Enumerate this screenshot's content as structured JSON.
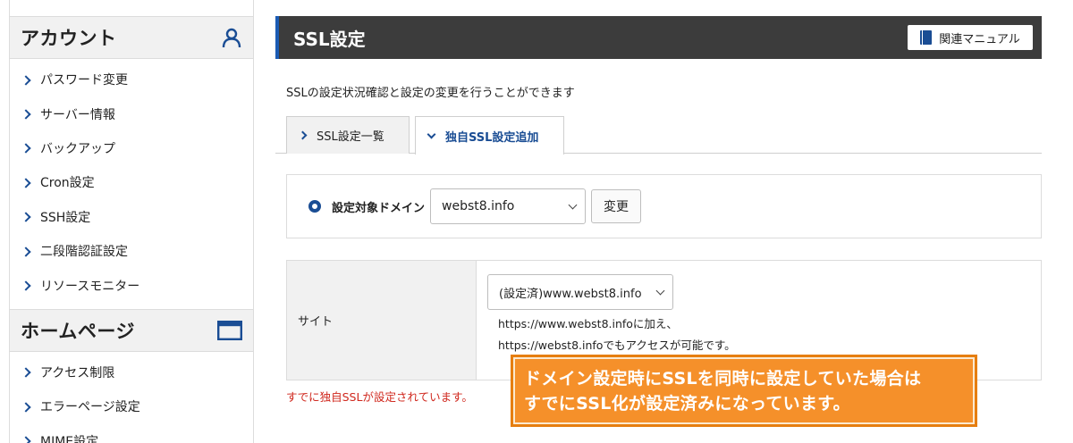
{
  "sidebar": {
    "account": {
      "title": "アカウント",
      "items": [
        {
          "label": "パスワード変更"
        },
        {
          "label": "サーバー情報"
        },
        {
          "label": "バックアップ"
        },
        {
          "label": "Cron設定"
        },
        {
          "label": "SSH設定"
        },
        {
          "label": "二段階認証設定"
        },
        {
          "label": "リソースモニター"
        }
      ]
    },
    "home": {
      "title": "ホームページ",
      "items": [
        {
          "label": "アクセス制限"
        },
        {
          "label": "エラーページ設定"
        },
        {
          "label": "MIME設定"
        }
      ]
    }
  },
  "header": {
    "title": "SSL設定",
    "manual_label": "関連マニュアル"
  },
  "description": "SSLの設定状況確認と設定の変更を行うことができます",
  "tabs": [
    {
      "label": "SSL設定一覧",
      "active": false
    },
    {
      "label": "独自SSL設定追加",
      "active": true
    }
  ],
  "domain_form": {
    "label": "設定対象ドメイン",
    "selected": "webst8.info",
    "change_label": "変更"
  },
  "site_row": {
    "header": "サイト",
    "selected": "(設定済)www.webst8.info",
    "note_line1": "https://www.webst8.infoに加え、",
    "note_line2": "https://webst8.infoでもアクセスが可能です。"
  },
  "status_message": "すでに独自SSLが設定されています。",
  "callout": {
    "line1": "ドメイン設定時にSSLを同時に設定していた場合は",
    "line2": "すでにSSL化が設定済みになっています。"
  },
  "colors": {
    "accent": "#1a4d94",
    "header_bg": "#3c3c3c",
    "callout_bg": "#f5902a",
    "error": "#d0281e"
  }
}
